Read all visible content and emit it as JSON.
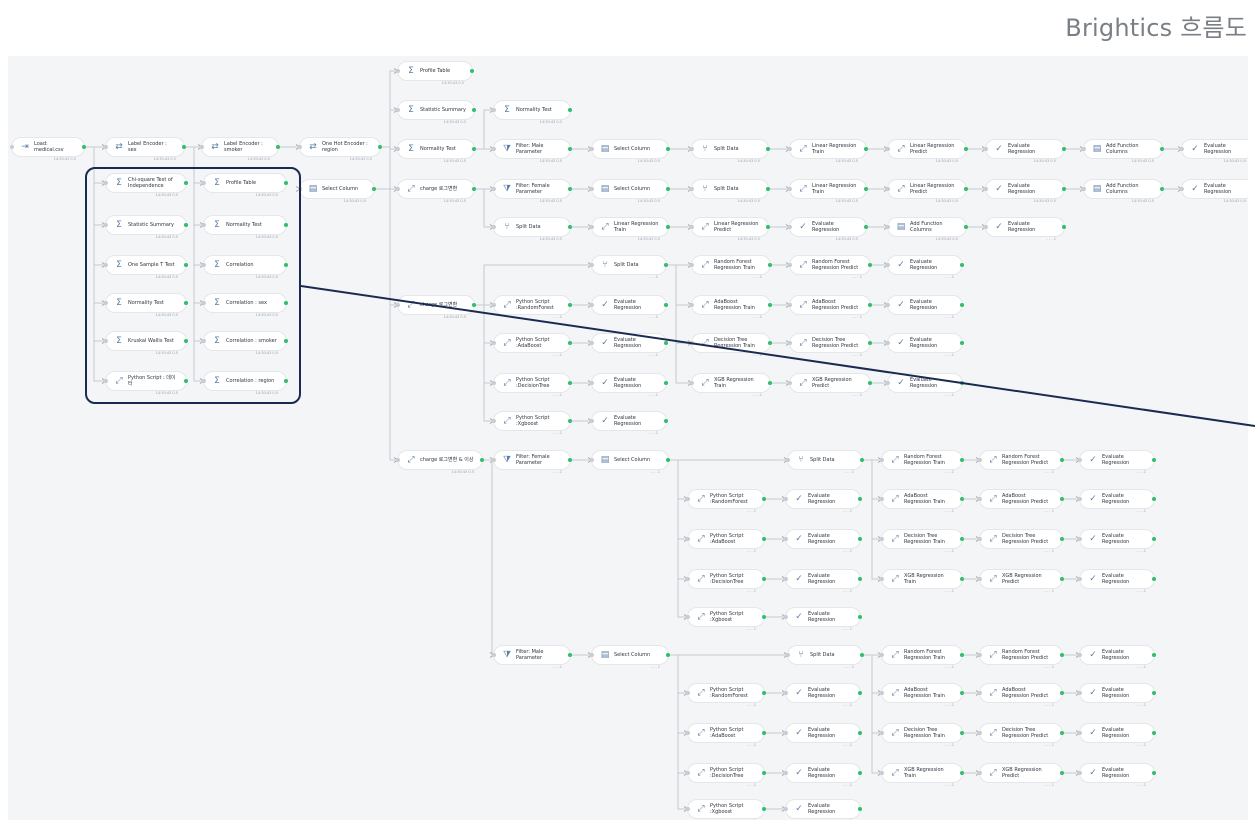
{
  "page_title": "Brightics 흐름도",
  "nodes": [
    {
      "id": "n1",
      "label": "Load: medical.csv",
      "sub": "14:30:43  0.5",
      "icon": "load"
    },
    {
      "id": "n2",
      "label": "Label Encoder : sex",
      "sub": "14:30:43  0.5",
      "icon": "encoder"
    },
    {
      "id": "n3",
      "label": "Label Encoder : smoker",
      "sub": "14:30:43  0.5",
      "icon": "encoder"
    },
    {
      "id": "n4",
      "label": "One Hot Encoder : region",
      "sub": "14:30:43  0.5",
      "icon": "encoder"
    },
    {
      "id": "s1",
      "label": "Profile Table",
      "sub": "14:30:43  0.5",
      "icon": "stat"
    },
    {
      "id": "s2",
      "label": "Statistic Summary",
      "sub": "14:30:43  0.5",
      "icon": "stat"
    },
    {
      "id": "s3",
      "label": "Normality Test",
      "sub": "14:30:43  0.5",
      "icon": "stat"
    },
    {
      "id": "s4",
      "label": "Select Column",
      "sub": "14:30:43  0.5",
      "icon": "select"
    },
    {
      "id": "s5",
      "label": "charge 로그변환",
      "sub": "14:30:43  0.5",
      "icon": "chart"
    },
    {
      "id": "s6",
      "label": "charge 로그변환",
      "sub": "14:30:43  0.5",
      "icon": "chart"
    },
    {
      "id": "s7",
      "label": "charge 로그변환 & 이상",
      "sub": "14:30:43  0.5",
      "icon": "chart"
    },
    {
      "id": "b1",
      "label": "Chi-square Test of Independence",
      "sub": "14:30:43  0.5",
      "icon": "stat"
    },
    {
      "id": "b2",
      "label": "Statistic Summary",
      "sub": "14:30:43  0.5",
      "icon": "stat"
    },
    {
      "id": "b3",
      "label": "One Sample T Test",
      "sub": "14:30:43  0.5",
      "icon": "stat"
    },
    {
      "id": "b4",
      "label": "Normality Test",
      "sub": "14:30:43  0.5",
      "icon": "stat"
    },
    {
      "id": "b5",
      "label": "Kruskal Wallis Test",
      "sub": "14:30:43  0.5",
      "icon": "stat"
    },
    {
      "id": "b6",
      "label": "Python Script : 데이터",
      "sub": "14:30:43  0.5",
      "icon": "chart"
    },
    {
      "id": "c1",
      "label": "Profile Table",
      "sub": "14:30:43  0.5",
      "icon": "stat"
    },
    {
      "id": "c2",
      "label": "Normality Test",
      "sub": "14:30:43  0.5",
      "icon": "stat"
    },
    {
      "id": "c3",
      "label": "Correlation",
      "sub": "14:30:43  0.5",
      "icon": "stat"
    },
    {
      "id": "c4",
      "label": "Correlation : sex",
      "sub": "14:30:43  0.5",
      "icon": "stat"
    },
    {
      "id": "c5",
      "label": "Correlation : smoker",
      "sub": "14:30:43  0.5",
      "icon": "stat"
    },
    {
      "id": "c6",
      "label": "Correlation : region",
      "sub": "14:30:43  0.5",
      "icon": "stat"
    },
    {
      "id": "r0",
      "label": "Normality Test",
      "sub": "14:30:43  0.5",
      "icon": "stat"
    },
    {
      "id": "r1a",
      "label": "Filter: Male Parameter",
      "sub": "14:30:43  0.5",
      "icon": "filter"
    },
    {
      "id": "r1b",
      "label": "Select Column",
      "sub": "14:30:43  0.5",
      "icon": "select"
    },
    {
      "id": "r1c",
      "label": "Split Data",
      "sub": "14:30:43  0.5",
      "icon": "split"
    },
    {
      "id": "r1d",
      "label": "Linear Regression Train",
      "sub": "14:30:43  0.5",
      "icon": "chart"
    },
    {
      "id": "r1e",
      "label": "Linear Regression Predict",
      "sub": "14:30:43  0.5",
      "icon": "chart"
    },
    {
      "id": "r1f",
      "label": "Evaluate Regression",
      "sub": "14:30:43  0.5",
      "icon": "eval"
    },
    {
      "id": "r1g",
      "label": "Add Function Columns",
      "sub": "14:30:43  0.5",
      "icon": "select"
    },
    {
      "id": "r1h",
      "label": "Evaluate Regression",
      "sub": "14:30:43  0.5",
      "icon": "eval"
    },
    {
      "id": "r2a",
      "label": "Filter: Female Parameter",
      "sub": "14:30:43  0.5",
      "icon": "filter"
    },
    {
      "id": "r2b",
      "label": "Select Column",
      "sub": "14:30:43  0.5",
      "icon": "select"
    },
    {
      "id": "r2c",
      "label": "Split Data",
      "sub": "14:30:43  0.5",
      "icon": "split"
    },
    {
      "id": "r2d",
      "label": "Linear Regression Train",
      "sub": "14:30:43  0.5",
      "icon": "chart"
    },
    {
      "id": "r2e",
      "label": "Linear Regression Predict",
      "sub": "14:30:43  0.5",
      "icon": "chart"
    },
    {
      "id": "r2f",
      "label": "Evaluate Regression",
      "sub": "14:30:43  0.5",
      "icon": "eval"
    },
    {
      "id": "r2g",
      "label": "Add Function Columns",
      "sub": "14:30:43  0.5",
      "icon": "select"
    },
    {
      "id": "r2h",
      "label": "Evaluate Regression",
      "sub": "14:30:43  0.5",
      "icon": "eval"
    },
    {
      "id": "r3a",
      "label": "Split Data",
      "sub": "14:30:43  0.5",
      "icon": "split"
    },
    {
      "id": "r3b",
      "label": "Linear Regression Train",
      "sub": "14:30:43  0.5",
      "icon": "chart"
    },
    {
      "id": "r3c",
      "label": "Linear Regression Predict",
      "sub": "14:30:43  0.5",
      "icon": "chart"
    },
    {
      "id": "r3d",
      "label": "Evaluate Regression",
      "sub": "14:30:43  0.5",
      "icon": "eval"
    },
    {
      "id": "r3e",
      "label": "Add Function Columns",
      "sub": "14:30:43  0.5",
      "icon": "select"
    },
    {
      "id": "r3f",
      "label": "Evaluate Regression",
      "sub": "- - - 1",
      "icon": "eval"
    },
    {
      "id": "m0",
      "label": "Split Data",
      "sub": "- - - 1",
      "icon": "split"
    },
    {
      "id": "m1",
      "label": "Python Script :RandomForest",
      "sub": "- - - 1",
      "icon": "chart"
    },
    {
      "id": "m2",
      "label": "Python Script :AdaBoost",
      "sub": "- - - 1",
      "icon": "chart"
    },
    {
      "id": "m3",
      "label": "Python Script :DecisionTree",
      "sub": "- - - 1",
      "icon": "chart"
    },
    {
      "id": "m4",
      "label": "Python Script :Xgboost",
      "sub": "- - - 1",
      "icon": "chart"
    },
    {
      "id": "me1",
      "label": "Evaluate Regression",
      "sub": "- - - 1",
      "icon": "eval"
    },
    {
      "id": "me2",
      "label": "Evaluate Regression",
      "sub": "- - - 1",
      "icon": "eval"
    },
    {
      "id": "me3",
      "label": "Evaluate Regression",
      "sub": "- - - 1",
      "icon": "eval"
    },
    {
      "id": "me4",
      "label": "Evaluate Regression",
      "sub": "- - - 1",
      "icon": "eval"
    },
    {
      "id": "mt1",
      "label": "Random Forest Regression Train",
      "sub": "- - - 1",
      "icon": "chart"
    },
    {
      "id": "mt2",
      "label": "AdaBoost Regression Train",
      "sub": "- - - 1",
      "icon": "chart"
    },
    {
      "id": "mt3",
      "label": "Decision Tree Regression Train",
      "sub": "- - - 1",
      "icon": "chart"
    },
    {
      "id": "mt4",
      "label": "XGB Regression Train",
      "sub": "- - - 1",
      "icon": "chart"
    },
    {
      "id": "mp1",
      "label": "Random Forest Regression Predict",
      "sub": "- - - 1",
      "icon": "chart"
    },
    {
      "id": "mp2",
      "label": "AdaBoost Regression Predict",
      "sub": "- - - 1",
      "icon": "chart"
    },
    {
      "id": "mp3",
      "label": "Decision Tree Regression Predict",
      "sub": "- - - 1",
      "icon": "chart"
    },
    {
      "id": "mp4",
      "label": "XGB Regression Predict",
      "sub": "- - - 1",
      "icon": "chart"
    },
    {
      "id": "mx1",
      "label": "Evaluate Regression",
      "sub": "- - - 1",
      "icon": "eval"
    },
    {
      "id": "mx2",
      "label": "Evaluate Regression",
      "sub": "- - - 1",
      "icon": "eval"
    },
    {
      "id": "mx3",
      "label": "Evaluate Regression",
      "sub": "- - - 1",
      "icon": "eval"
    },
    {
      "id": "mx4",
      "label": "Evaluate Regression",
      "sub": "- - - 1",
      "icon": "eval"
    },
    {
      "id": "fa",
      "label": "Filter: Female Parameter",
      "sub": "- - - 1",
      "icon": "filter"
    },
    {
      "id": "fb",
      "label": "Select Column",
      "sub": "- - - 1",
      "icon": "select"
    },
    {
      "id": "fc",
      "label": "Split Data",
      "sub": "- - - 1",
      "icon": "split"
    },
    {
      "id": "fp1",
      "label": "Python Script :RandomForest",
      "sub": "- - - 1",
      "icon": "chart"
    },
    {
      "id": "fp2",
      "label": "Python Script :AdaBoost",
      "sub": "- - - 1",
      "icon": "chart"
    },
    {
      "id": "fp3",
      "label": "Python Script :DecisionTree",
      "sub": "- - - 1",
      "icon": "chart"
    },
    {
      "id": "fp4",
      "label": "Python Script :Xgboost",
      "sub": "- - - 1",
      "icon": "chart"
    },
    {
      "id": "fe1",
      "label": "Evaluate Regression",
      "sub": "- - - 1",
      "icon": "eval"
    },
    {
      "id": "fe2",
      "label": "Evaluate Regression",
      "sub": "- - - 1",
      "icon": "eval"
    },
    {
      "id": "fe3",
      "label": "Evaluate Regression",
      "sub": "- - - 1",
      "icon": "eval"
    },
    {
      "id": "fe4",
      "label": "Evaluate Regression",
      "sub": "- - - 1",
      "icon": "eval"
    },
    {
      "id": "ft1",
      "label": "Random Forest Regression Train",
      "sub": "- - - 1",
      "icon": "chart"
    },
    {
      "id": "ft2",
      "label": "AdaBoost Regression Train",
      "sub": "- - - 1",
      "icon": "chart"
    },
    {
      "id": "ft3",
      "label": "Decision Tree Regression Train",
      "sub": "- - - 1",
      "icon": "chart"
    },
    {
      "id": "ft4",
      "label": "XGB Regression Train",
      "sub": "- - - 1",
      "icon": "chart"
    },
    {
      "id": "fq1",
      "label": "Random Forest Regression Predict",
      "sub": "- - - 1",
      "icon": "chart"
    },
    {
      "id": "fq2",
      "label": "AdaBoost Regression Predict",
      "sub": "- - - 1",
      "icon": "chart"
    },
    {
      "id": "fq3",
      "label": "Decision Tree Regression Predict",
      "sub": "- - - 1",
      "icon": "chart"
    },
    {
      "id": "fq4",
      "label": "XGB Regression Predict",
      "sub": "- - - 1",
      "icon": "chart"
    },
    {
      "id": "fx1",
      "label": "Evaluate Regression",
      "sub": "- - - 1",
      "icon": "eval"
    },
    {
      "id": "fx2",
      "label": "Evaluate Regression",
      "sub": "- - - 1",
      "icon": "eval"
    },
    {
      "id": "fx3",
      "label": "Evaluate Regression",
      "sub": "- - - 1",
      "icon": "eval"
    },
    {
      "id": "fx4",
      "label": "Evaluate Regression",
      "sub": "- - - 1",
      "icon": "eval"
    },
    {
      "id": "ga",
      "label": "Filter: Male Parameter",
      "sub": "- - - 1",
      "icon": "filter"
    },
    {
      "id": "gb",
      "label": "Select Column",
      "sub": "- - - 1",
      "icon": "select"
    },
    {
      "id": "gc",
      "label": "Split Data",
      "sub": "- - - 1",
      "icon": "split"
    },
    {
      "id": "gp1",
      "label": "Python Script :RandomForest",
      "sub": "- - - 1",
      "icon": "chart"
    },
    {
      "id": "gp2",
      "label": "Python Script :AdaBoost",
      "sub": "- - - 1",
      "icon": "chart"
    },
    {
      "id": "gp3",
      "label": "Python Script :DecisionTree",
      "sub": "- - - 1",
      "icon": "chart"
    },
    {
      "id": "gp4",
      "label": "Python Script :Xgboost",
      "sub": "- - - 1",
      "icon": "chart"
    },
    {
      "id": "ge1",
      "label": "Evaluate Regression",
      "sub": "- - - 1",
      "icon": "eval"
    },
    {
      "id": "ge2",
      "label": "Evaluate Regression",
      "sub": "- - - 1",
      "icon": "eval"
    },
    {
      "id": "ge3",
      "label": "Evaluate Regression",
      "sub": "- - - 1",
      "icon": "eval"
    },
    {
      "id": "ge4",
      "label": "Evaluate Regression",
      "sub": "- - - 1",
      "icon": "eval"
    },
    {
      "id": "gt1",
      "label": "Random Forest Regression Train",
      "sub": "- - - 1",
      "icon": "chart"
    },
    {
      "id": "gt2",
      "label": "AdaBoost Regression Train",
      "sub": "- - - 1",
      "icon": "chart"
    },
    {
      "id": "gt3",
      "label": "Decision Tree Regression Train",
      "sub": "- - - 1",
      "icon": "chart"
    },
    {
      "id": "gt4",
      "label": "XGB Regression Train",
      "sub": "- - - 1",
      "icon": "chart"
    },
    {
      "id": "gq1",
      "label": "Random Forest Regression Predict",
      "sub": "- - - 1",
      "icon": "chart"
    },
    {
      "id": "gq2",
      "label": "AdaBoost Regression Predict",
      "sub": "- - - 1",
      "icon": "chart"
    },
    {
      "id": "gq3",
      "label": "Decision Tree Regression Predict",
      "sub": "- - - 1",
      "icon": "chart"
    },
    {
      "id": "gq4",
      "label": "XGB Regression Predict",
      "sub": "- - - 1",
      "icon": "chart"
    },
    {
      "id": "gx1",
      "label": "Evaluate Regression",
      "sub": "- - - 1",
      "icon": "eval"
    },
    {
      "id": "gx2",
      "label": "Evaluate Regression",
      "sub": "- - - 1",
      "icon": "eval"
    },
    {
      "id": "gx3",
      "label": "Evaluate Regression",
      "sub": "- - - 1",
      "icon": "eval"
    },
    {
      "id": "gx4",
      "label": "Evaluate Regression",
      "sub": "- - - 1",
      "icon": "eval"
    }
  ],
  "edges": [
    [
      "n1",
      "n2"
    ],
    [
      "n2",
      "n3"
    ],
    [
      "n3",
      "n4"
    ],
    [
      "n4",
      "s3"
    ],
    [
      "n4",
      "s1"
    ],
    [
      "n4",
      "s2"
    ],
    [
      "n4",
      "s4"
    ],
    [
      "n4",
      "s5"
    ],
    [
      "n4",
      "s6"
    ],
    [
      "n4",
      "s7"
    ],
    [
      "n1",
      "b1"
    ],
    [
      "n1",
      "b2"
    ],
    [
      "n1",
      "b3"
    ],
    [
      "n1",
      "b4"
    ],
    [
      "n1",
      "b5"
    ],
    [
      "n1",
      "b6"
    ],
    [
      "n2",
      "c1"
    ],
    [
      "n2",
      "c2"
    ],
    [
      "n2",
      "c3"
    ],
    [
      "n2",
      "c4"
    ],
    [
      "n2",
      "c5"
    ],
    [
      "n2",
      "c6"
    ],
    [
      "s3",
      "r0"
    ],
    [
      "s3",
      "r1a"
    ],
    [
      "r1a",
      "r1b"
    ],
    [
      "r1b",
      "r1c"
    ],
    [
      "r1c",
      "r1d"
    ],
    [
      "r1d",
      "r1e"
    ],
    [
      "r1e",
      "r1f"
    ],
    [
      "r1f",
      "r1g"
    ],
    [
      "r1g",
      "r1h"
    ],
    [
      "s5",
      "r2a"
    ],
    [
      "r2a",
      "r2b"
    ],
    [
      "r2b",
      "r2c"
    ],
    [
      "r2c",
      "r2d"
    ],
    [
      "r2d",
      "r2e"
    ],
    [
      "r2e",
      "r2f"
    ],
    [
      "r2f",
      "r2g"
    ],
    [
      "r2g",
      "r2h"
    ],
    [
      "s5",
      "r3a"
    ],
    [
      "r3a",
      "r3b"
    ],
    [
      "r3b",
      "r3c"
    ],
    [
      "r3c",
      "r3d"
    ],
    [
      "r3d",
      "r3e"
    ],
    [
      "r3e",
      "r3f"
    ],
    [
      "s6",
      "m0"
    ],
    [
      "s6",
      "m1"
    ],
    [
      "s6",
      "m2"
    ],
    [
      "s6",
      "m3"
    ],
    [
      "s6",
      "m4"
    ],
    [
      "m1",
      "me1"
    ],
    [
      "m2",
      "me2"
    ],
    [
      "m3",
      "me3"
    ],
    [
      "m4",
      "me4"
    ],
    [
      "m0",
      "mt1"
    ],
    [
      "m0",
      "mt2"
    ],
    [
      "m0",
      "mt3"
    ],
    [
      "m0",
      "mt4"
    ],
    [
      "mt1",
      "mp1"
    ],
    [
      "mt2",
      "mp2"
    ],
    [
      "mt3",
      "mp3"
    ],
    [
      "mt4",
      "mp4"
    ],
    [
      "mp1",
      "mx1"
    ],
    [
      "mp2",
      "mx2"
    ],
    [
      "mp3",
      "mx3"
    ],
    [
      "mp4",
      "mx4"
    ],
    [
      "s7",
      "fa"
    ],
    [
      "fa",
      "fb"
    ],
    [
      "fb",
      "fc"
    ],
    [
      "fb",
      "fp1"
    ],
    [
      "fb",
      "fp2"
    ],
    [
      "fb",
      "fp3"
    ],
    [
      "fb",
      "fp4"
    ],
    [
      "fp1",
      "fe1"
    ],
    [
      "fp2",
      "fe2"
    ],
    [
      "fp3",
      "fe3"
    ],
    [
      "fp4",
      "fe4"
    ],
    [
      "fc",
      "ft1"
    ],
    [
      "fc",
      "ft2"
    ],
    [
      "fc",
      "ft3"
    ],
    [
      "fc",
      "ft4"
    ],
    [
      "ft1",
      "fq1"
    ],
    [
      "ft2",
      "fq2"
    ],
    [
      "ft3",
      "fq3"
    ],
    [
      "ft4",
      "fq4"
    ],
    [
      "fq1",
      "fx1"
    ],
    [
      "fq2",
      "fx2"
    ],
    [
      "fq3",
      "fx3"
    ],
    [
      "fq4",
      "fx4"
    ],
    [
      "s7",
      "ga"
    ],
    [
      "ga",
      "gb"
    ],
    [
      "gb",
      "gc"
    ],
    [
      "gb",
      "gp1"
    ],
    [
      "gb",
      "gp2"
    ],
    [
      "gb",
      "gp3"
    ],
    [
      "gb",
      "gp4"
    ],
    [
      "gp1",
      "ge1"
    ],
    [
      "gp2",
      "ge2"
    ],
    [
      "gp3",
      "ge3"
    ],
    [
      "gp4",
      "ge4"
    ],
    [
      "gc",
      "gt1"
    ],
    [
      "gc",
      "gt2"
    ],
    [
      "gc",
      "gt3"
    ],
    [
      "gc",
      "gt4"
    ],
    [
      "gt1",
      "gq1"
    ],
    [
      "gt2",
      "gq2"
    ],
    [
      "gt3",
      "gq3"
    ],
    [
      "gt4",
      "gq4"
    ],
    [
      "gq1",
      "gx1"
    ],
    [
      "gq2",
      "gx2"
    ],
    [
      "gq3",
      "gx3"
    ],
    [
      "gq4",
      "gx4"
    ]
  ],
  "colors": {
    "edge": "#c4c9cf",
    "port_out": "#2fbf6b",
    "highlight": "#1a2b52",
    "icon": "#5b7fa8"
  }
}
